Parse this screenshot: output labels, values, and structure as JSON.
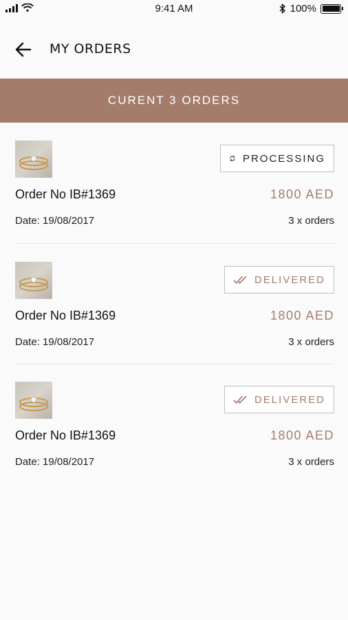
{
  "status_bar": {
    "time": "9:41 AM",
    "battery": "100%",
    "icons": [
      "signal-icon",
      "wifi-icon",
      "bluetooth-icon",
      "battery-icon"
    ]
  },
  "header": {
    "back_icon": "arrow-left-icon",
    "title": "MY ORDERS"
  },
  "banner": {
    "text": "CURENT 3 ORDERS"
  },
  "colors": {
    "accent": "#a47c6c",
    "background": "#fafafa"
  },
  "orders": [
    {
      "title": "Order No IB#1369",
      "date": "Date: 19/08/2017",
      "price": "1800 AED",
      "count": "3 x orders",
      "status": "PROCESSING",
      "status_icon": "refresh-icon"
    },
    {
      "title": "Order No IB#1369",
      "date": "Date: 19/08/2017",
      "price": "1800 AED",
      "count": "3 x orders",
      "status": "DELIVERED",
      "status_icon": "double-check-icon"
    },
    {
      "title": "Order No IB#1369",
      "date": "Date: 19/08/2017",
      "price": "1800 AED",
      "count": "3 x orders",
      "status": "DELIVERED",
      "status_icon": "double-check-icon"
    }
  ]
}
